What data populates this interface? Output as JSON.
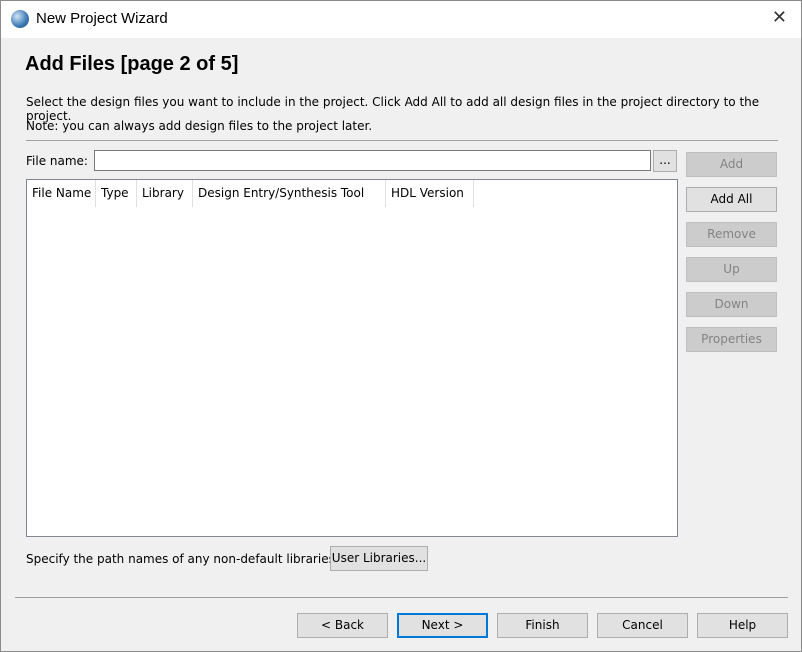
{
  "window": {
    "title": "New Project Wizard"
  },
  "page": {
    "heading": "Add Files [page 2 of 5]",
    "description": "Select the design files you want to include in the project. Click Add All to add all design files in the project directory to the project.",
    "note": "Note: you can always add design files to the project later."
  },
  "file": {
    "label": "File name:",
    "value": "",
    "browse_label": "..."
  },
  "table": {
    "columns": [
      "File Name",
      "Type",
      "Library",
      "Design Entry/Synthesis Tool",
      "HDL Version"
    ],
    "rows": []
  },
  "side_buttons": {
    "add": "Add",
    "add_all": "Add All",
    "remove": "Remove",
    "up": "Up",
    "down": "Down",
    "properties": "Properties"
  },
  "libraries": {
    "text": "Specify the path names of any non-default libraries.",
    "button": "User Libraries..."
  },
  "footer": {
    "back": "< Back",
    "next": "Next >",
    "finish": "Finish",
    "cancel": "Cancel",
    "help": "Help"
  }
}
